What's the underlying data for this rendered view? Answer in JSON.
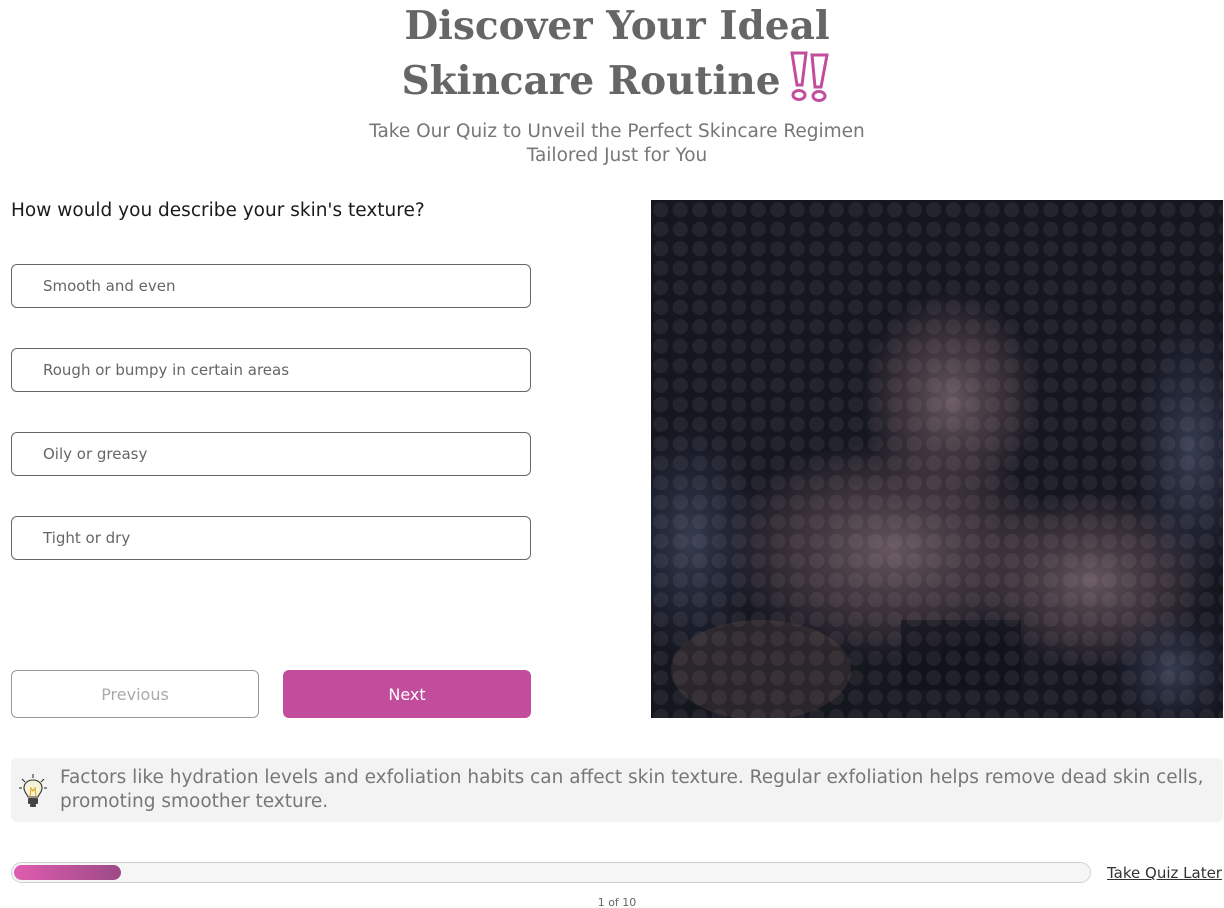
{
  "header": {
    "title_line1": "Discover Your Ideal",
    "title_line2": "Skincare Routine",
    "subtitle_line1": "Take Our Quiz to Unveil the Perfect Skincare Regimen",
    "subtitle_line2": "Tailored Just for You",
    "accent_icon": "double-exclamation-icon"
  },
  "quiz": {
    "question": "How would you describe your skin's texture?",
    "options": [
      "Smooth and even",
      "Rough or bumpy in certain areas",
      "Oily or greasy",
      "Tight or dry"
    ],
    "previous_label": "Previous",
    "next_label": "Next"
  },
  "tip": {
    "icon": "lightbulb-icon",
    "text": "Factors like hydration levels and exfoliation habits can affect skin texture. Regular exfoliation helps remove dead skin cells, promoting smoother texture."
  },
  "progress": {
    "current": 1,
    "total": 10,
    "fraction": 0.1,
    "label": "1 of 10",
    "later_label": "Take Quiz Later"
  },
  "colors": {
    "accent": "#c24d9c",
    "title": "#666666",
    "progress_start": "#e05cb0",
    "progress_end": "#9c4a86"
  }
}
